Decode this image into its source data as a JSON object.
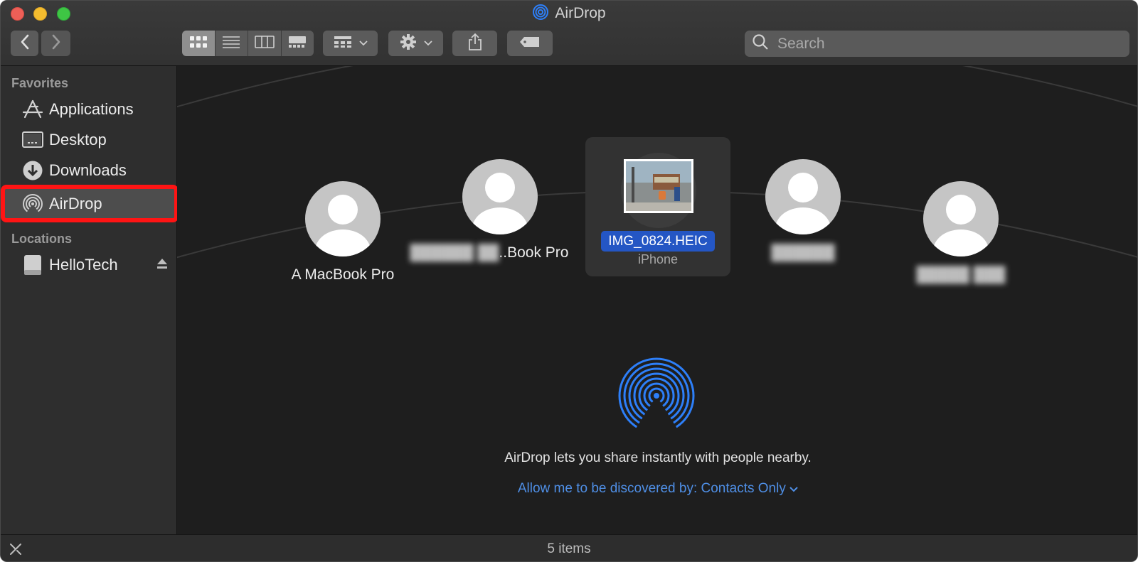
{
  "window": {
    "title": "AirDrop"
  },
  "toolbar": {
    "back_icon": "chevron-left-icon",
    "forward_icon": "chevron-right-icon",
    "view_modes": [
      "icon-view",
      "list-view",
      "column-view",
      "gallery-view"
    ],
    "active_view": "icon-view",
    "group_icon": "group-by-icon",
    "action_icon": "gear-icon",
    "share_icon": "share-icon",
    "tag_icon": "tag-icon",
    "search_placeholder": "Search"
  },
  "sidebar": {
    "favorites_heading": "Favorites",
    "favorites": [
      {
        "label": "Applications",
        "icon": "applications-icon"
      },
      {
        "label": "Desktop",
        "icon": "desktop-icon"
      },
      {
        "label": "Downloads",
        "icon": "downloads-icon"
      },
      {
        "label": "AirDrop",
        "icon": "airdrop-icon",
        "selected": true
      }
    ],
    "locations_heading": "Locations",
    "locations": [
      {
        "label": "HelloTech",
        "icon": "drive-icon",
        "ejectable": true
      }
    ]
  },
  "main": {
    "devices": [
      {
        "name": "A MacBook Pro",
        "blurred": false
      },
      {
        "name_blurred_part": "██████ ██",
        "name_visible_part": "..Book Pro"
      },
      {
        "name": "██████",
        "blurred": true
      },
      {
        "name": "█████ ███",
        "blurred": true
      }
    ],
    "selected_item": {
      "file_name": "IMG_0824.HEIC",
      "device": "iPhone"
    },
    "share_message": "AirDrop lets you share instantly with people nearby.",
    "discover_label": "Allow me to be discovered by: Contacts Only",
    "discover_chevron": "chevron-down-icon"
  },
  "status": {
    "item_count": "5 items"
  },
  "colors": {
    "accent_blue": "#2d7ff9",
    "selection_blue": "#2456c4",
    "link_blue": "#4f8fe6",
    "highlight_red": "#ff1414"
  }
}
